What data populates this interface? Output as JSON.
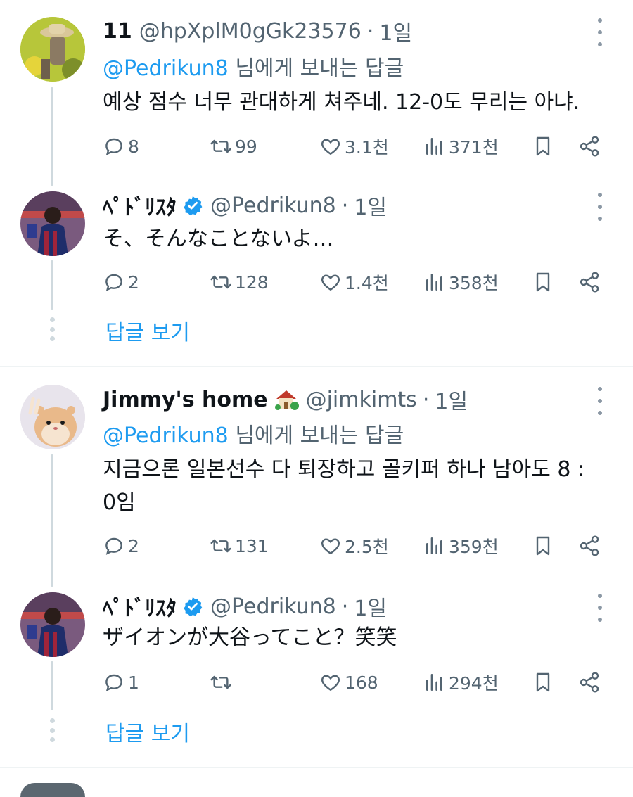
{
  "colors": {
    "accent": "#1d9bf0",
    "secondary": "#536471",
    "text": "#0f1419",
    "line": "#cfd9de"
  },
  "tweets": [
    {
      "name": "11",
      "handle": "@hpXplM0gGk23576",
      "time": "1일",
      "reply_mention": "@Pedrikun8",
      "reply_suffix": "님에게 보내는 답글",
      "text": "예상 점수 너무 관대하게 쳐주네. 12-0도 무리는 아냐.",
      "replies": "8",
      "retweets": "99",
      "likes": "3.1천",
      "views": "371천",
      "avatar_icon": "farmer-straw-hat-avatar"
    },
    {
      "name": "ﾍﾟﾄﾞﾘｽﾀ",
      "verified": true,
      "handle": "@Pedrikun8",
      "time": "1일",
      "text": "そ、そんなことないよ…",
      "replies": "2",
      "retweets": "128",
      "likes": "1.4천",
      "views": "358천",
      "avatar_icon": "stadium-fan-avatar"
    },
    {
      "name": "Jimmy's home",
      "name_emoji": "house-with-garden-icon",
      "handle": "@jimkimts",
      "time": "1일",
      "reply_mention": "@Pedrikun8",
      "reply_suffix": "님에게 보내는 답글",
      "text_line1": "지금으론 일본선수 다 퇴장하고 골키퍼 하나 남아도 8 :",
      "text_line2": "0임",
      "replies": "2",
      "retweets": "131",
      "likes": "2.5천",
      "views": "359천",
      "avatar_icon": "hamster-peace-avatar"
    },
    {
      "name": "ﾍﾟﾄﾞﾘｽﾀ",
      "verified": true,
      "handle": "@Pedrikun8",
      "time": "1일",
      "text": "ザイオンが大谷ってこと？笑笑",
      "replies": "1",
      "retweets": "",
      "likes": "168",
      "views": "294천",
      "avatar_icon": "stadium-fan-avatar"
    }
  ],
  "show_replies_label": "답글 보기"
}
